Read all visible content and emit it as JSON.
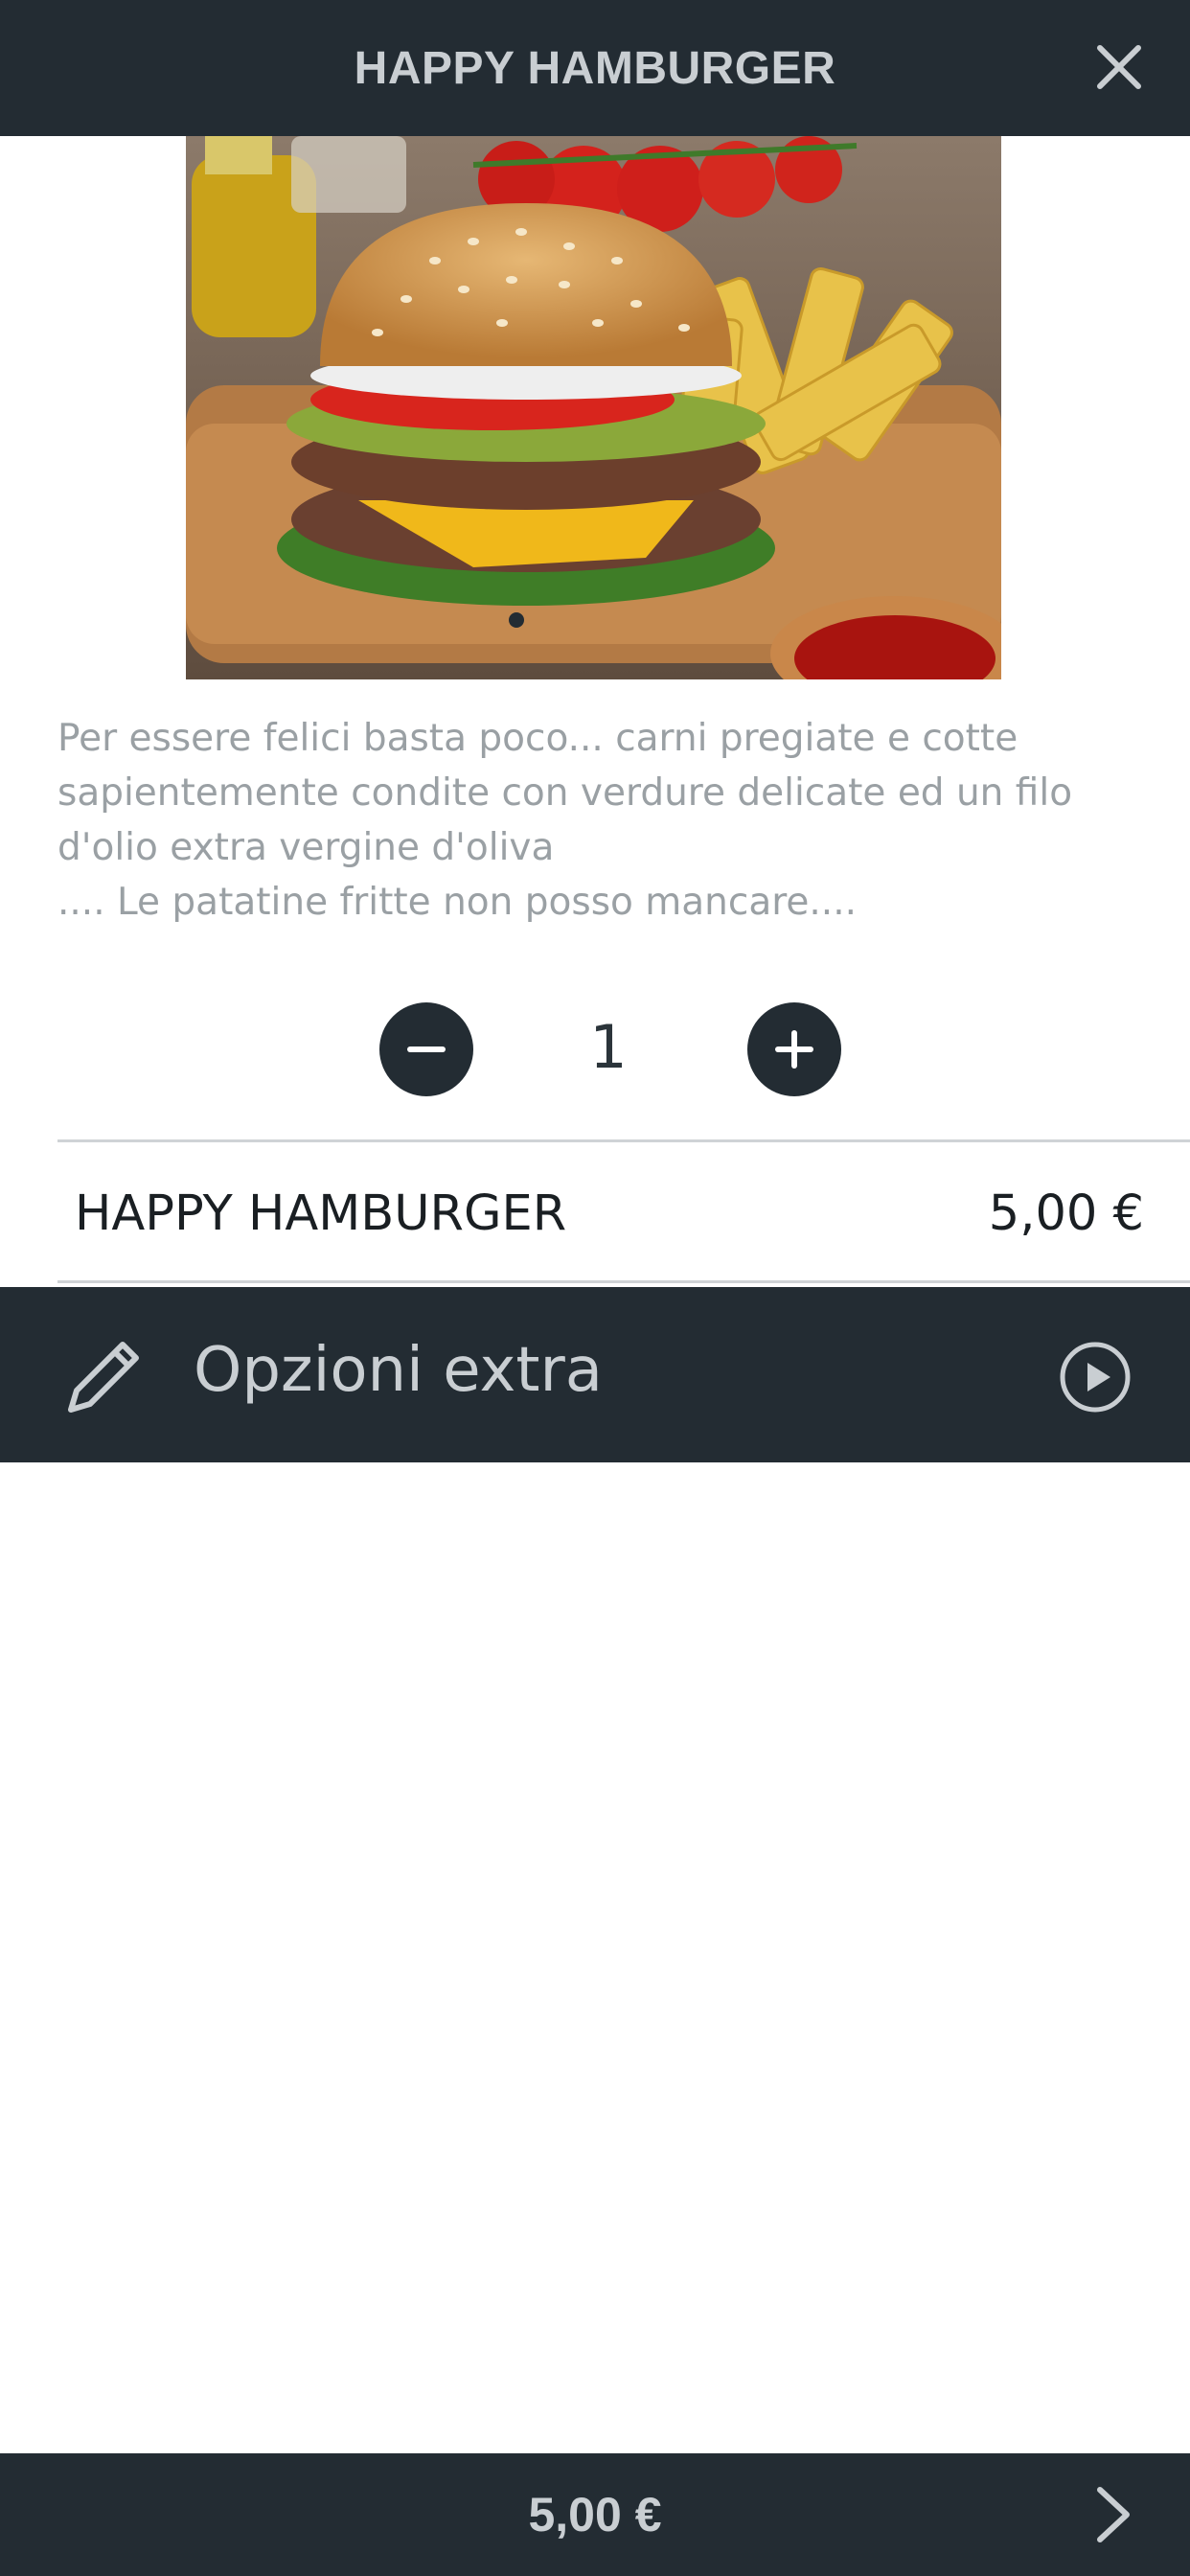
{
  "header": {
    "title": "HAPPY HAMBURGER",
    "close_icon": "close-icon"
  },
  "product": {
    "image_alt": "Hamburger con patatine",
    "description_lines": [
      "Per essere felici basta poco... carni pregiate e cotte",
      "sapientemente condite con verdure delicate ed un filo",
      "d'olio extra vergine d'oliva",
      ".... Le patatine fritte non posso mancare...."
    ]
  },
  "quantity": {
    "value": "1",
    "minus_icon": "minus-circle-icon",
    "plus_icon": "plus-circle-icon"
  },
  "line_item": {
    "name": "HAPPY HAMBURGER",
    "price": "5,00 €"
  },
  "extra_options": {
    "label": "Opzioni extra",
    "icon_left": "pencil-icon",
    "icon_right": "play-circle-icon"
  },
  "footer": {
    "total": "5,00 €",
    "next_icon": "chevron-right-icon"
  },
  "colors": {
    "dark_bar": "#232c33",
    "bar_text": "#c9ced2",
    "description_text": "#9aa0a4",
    "divider": "#cfd3d6"
  }
}
